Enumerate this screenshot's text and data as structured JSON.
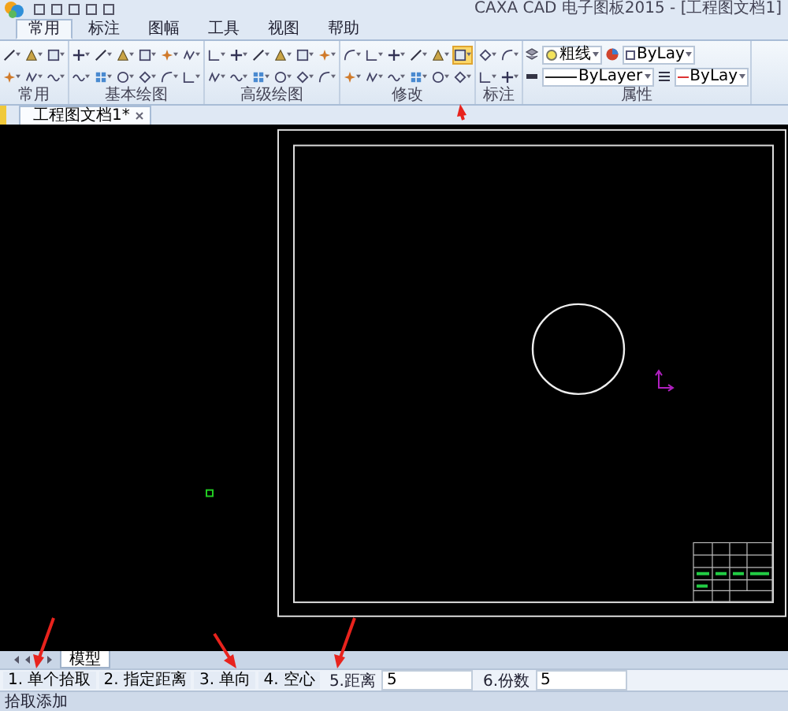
{
  "window": {
    "title": "CAXA CAD 电子图板2015 - [工程图文档1]"
  },
  "ribbon_tabs": [
    {
      "label": "常用",
      "selected": true
    },
    {
      "label": "标注",
      "selected": false
    },
    {
      "label": "图幅",
      "selected": false
    },
    {
      "label": "工具",
      "selected": false
    },
    {
      "label": "视图",
      "selected": false
    },
    {
      "label": "帮助",
      "selected": false
    }
  ],
  "ribbon_groups": [
    {
      "label": "常用",
      "tools": [
        {
          "selected": false
        },
        {
          "selected": false
        },
        {
          "selected": false
        },
        {
          "selected": false
        },
        {
          "selected": false
        },
        {
          "selected": false
        }
      ]
    },
    {
      "label": "基本绘图",
      "tools": [
        {
          "selected": false
        },
        {
          "selected": false
        },
        {
          "selected": false
        },
        {
          "selected": false
        },
        {
          "selected": false
        },
        {
          "selected": false
        },
        {
          "selected": false
        },
        {
          "selected": false
        },
        {
          "selected": false
        },
        {
          "selected": false
        },
        {
          "selected": false
        },
        {
          "selected": false
        }
      ]
    },
    {
      "label": "高级绘图",
      "tools": [
        {
          "selected": false
        },
        {
          "selected": false
        },
        {
          "selected": false
        },
        {
          "selected": false
        },
        {
          "selected": false
        },
        {
          "selected": false
        },
        {
          "selected": false
        },
        {
          "selected": false
        },
        {
          "selected": false
        },
        {
          "selected": false
        },
        {
          "selected": false
        },
        {
          "selected": false
        }
      ]
    },
    {
      "label": "修改",
      "tools": [
        {
          "selected": false
        },
        {
          "selected": false
        },
        {
          "selected": false
        },
        {
          "selected": false
        },
        {
          "selected": false
        },
        {
          "selected": true
        },
        {
          "selected": false
        },
        {
          "selected": false
        },
        {
          "selected": false
        },
        {
          "selected": false
        },
        {
          "selected": false
        },
        {
          "selected": false
        }
      ]
    },
    {
      "label": "标注",
      "tools": [
        {
          "selected": false
        },
        {
          "selected": false
        },
        {
          "selected": false
        },
        {
          "selected": false
        }
      ]
    }
  ],
  "properties": {
    "label": "属性",
    "line_weight": "粗线",
    "color_setting": "ByLay",
    "line_type": "ByLayer",
    "line_color": "ByLay"
  },
  "document_tab": {
    "label": "工程图文档1*"
  },
  "layout_tabs": [
    {
      "label": "模型",
      "selected": true
    }
  ],
  "command_bar": {
    "options": [
      "1. 单个拾取",
      "2. 指定距离",
      "3. 单向",
      "4. 空心"
    ],
    "distance": {
      "label": "5.距离",
      "value": "5"
    },
    "count": {
      "label": "6.份数",
      "value": "5"
    }
  },
  "status_bar": {
    "text": "拾取添加"
  }
}
